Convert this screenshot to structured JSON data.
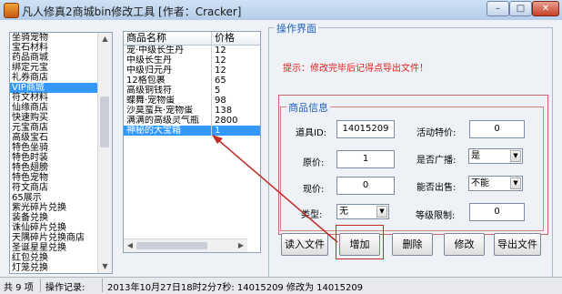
{
  "window": {
    "title": "凡人修真2商城bin修改工具 [作者：Cracker]"
  },
  "categories": [
    "坐骑宠物",
    "宝石材料",
    "药品商城",
    "绑定元宝",
    "礼券商店",
    "VIP商城",
    "符文材料",
    "仙缘商店",
    "快速购买",
    "元宝商店",
    "高级宝石",
    "特色坐骑",
    "特色时装",
    "特色翅膀",
    "特色宠物",
    "符文商店",
    "65展示",
    "紫光碎片兑换",
    "装备兑换",
    "诛仙碎片兑换",
    "天隅碎片兑换商店",
    "圣诞星星兑换",
    "红包兑换",
    "灯笼兑换"
  ],
  "products": {
    "headers": {
      "name": "商品名称",
      "price": "价格"
    },
    "rows": [
      {
        "name": "宠·中级长生丹",
        "price": "12"
      },
      {
        "name": "中级长生丹",
        "price": "12"
      },
      {
        "name": "中级归元丹",
        "price": "12"
      },
      {
        "name": "12格包裹",
        "price": "65"
      },
      {
        "name": "高级铜钱符",
        "price": "5"
      },
      {
        "name": "蝶舞·宠物蛋",
        "price": "98"
      },
      {
        "name": "沙莫蛮兵·宠物蛋",
        "price": "138"
      },
      {
        "name": "满满的高级灵气瓶",
        "price": "2800"
      },
      {
        "name": "神秘的大宝箱",
        "price": "1"
      }
    ]
  },
  "ops": {
    "group_title": "操作界面",
    "hint": "提示：修改完毕后记得点导出文件！",
    "info_title": "商品信息",
    "labels": {
      "item_id": "道具ID:",
      "promo_price": "活动特价:",
      "orig_price": "原价:",
      "broadcast": "是否广播:",
      "cur_price": "现价:",
      "can_sell": "能否出售:",
      "type": "类型:",
      "level_limit": "等级限制:"
    },
    "values": {
      "item_id": "14015209",
      "promo_price": "0",
      "orig_price": "1",
      "broadcast": "是",
      "cur_price": "0",
      "can_sell": "不能",
      "type": "无",
      "level_limit": "0"
    }
  },
  "buttons": {
    "read": "读入文件",
    "add": "增加",
    "delete": "删除",
    "modify": "修改",
    "export": "导出文件"
  },
  "status": {
    "count": "共 9 项",
    "log_label": "操作记录:",
    "log_text": "2013年10月27日18时2分7秒: 14015209 修改为 14015209"
  },
  "colors": {
    "selection": "#3399ff",
    "hint": "#e0201a",
    "annotation": "#c02a24"
  }
}
